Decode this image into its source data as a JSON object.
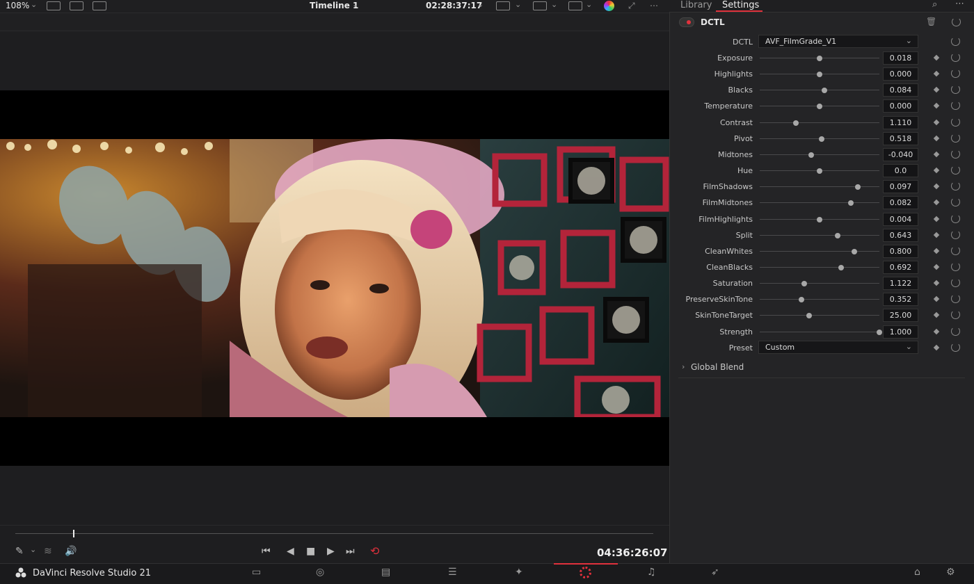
{
  "viewer": {
    "zoom": "108%",
    "timeline": "Timeline 1",
    "timecode_top": "02:28:37:17",
    "timecode_bottom": "04:36:26:07",
    "playhead_fraction": 0.09
  },
  "panel": {
    "tabs": [
      "Library",
      "Settings"
    ],
    "active_tab": "Settings",
    "section_title": "DCTL",
    "dctl_label": "DCTL",
    "dctl_value": "AVF_FilmGrade_V1",
    "params": [
      {
        "label": "Exposure",
        "value": "0.018",
        "pos": 0.5
      },
      {
        "label": "Highlights",
        "value": "0.000",
        "pos": 0.5
      },
      {
        "label": "Blacks",
        "value": "0.084",
        "pos": 0.54
      },
      {
        "label": "Temperature",
        "value": "0.000",
        "pos": 0.5
      },
      {
        "label": "Contrast",
        "value": "1.110",
        "pos": 0.3
      },
      {
        "label": "Pivot",
        "value": "0.518",
        "pos": 0.52
      },
      {
        "label": "Midtones",
        "value": "-0.040",
        "pos": 0.43
      },
      {
        "label": "Hue",
        "value": "0.0",
        "pos": 0.5
      },
      {
        "label": "FilmShadows",
        "value": "0.097",
        "pos": 0.82
      },
      {
        "label": "FilmMidtones",
        "value": "0.082",
        "pos": 0.76
      },
      {
        "label": "FilmHighlights",
        "value": "0.004",
        "pos": 0.5
      },
      {
        "label": "Split",
        "value": "0.643",
        "pos": 0.65
      },
      {
        "label": "CleanWhites",
        "value": "0.800",
        "pos": 0.79
      },
      {
        "label": "CleanBlacks",
        "value": "0.692",
        "pos": 0.68
      },
      {
        "label": "Saturation",
        "value": "1.122",
        "pos": 0.37
      },
      {
        "label": "PreserveSkinTone",
        "value": "0.352",
        "pos": 0.35
      },
      {
        "label": "SkinToneTarget",
        "value": "25.00",
        "pos": 0.41
      },
      {
        "label": "Strength",
        "value": "1.000",
        "pos": 1.0
      }
    ],
    "preset_label": "Preset",
    "preset_value": "Custom",
    "global_blend": "Global Blend"
  },
  "app": {
    "name": "DaVinci Resolve Studio 21"
  },
  "colors": {
    "accent": "#e0313c",
    "panel_bg": "#242426"
  }
}
